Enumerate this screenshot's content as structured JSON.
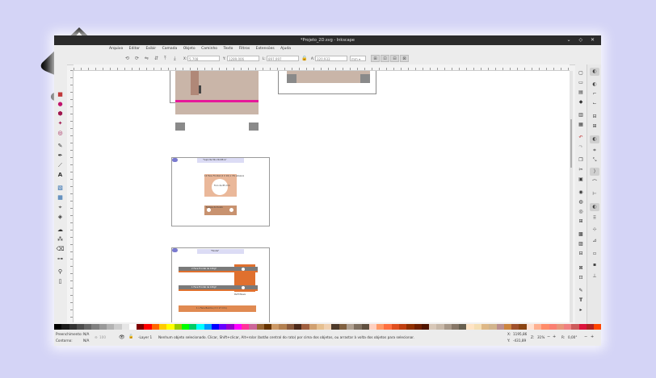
{
  "window": {
    "title": "*Projeto_2D.svg - Inkscape",
    "controls": "⌄ ◇ ✕"
  },
  "menubar": [
    "Arquivo",
    "Editar",
    "Exibir",
    "Camada",
    "Objeto",
    "Caminho",
    "Texto",
    "Filtros",
    "Extensões",
    "Ajuda"
  ],
  "controlbar": {
    "x_label": "X:",
    "x_value": "5,708",
    "y_label": "Y:",
    "y_value": "1289,006",
    "w_label": "L:",
    "w_value": "897,997",
    "h_label": "A:",
    "h_value": "320,933",
    "units": "mm",
    "units_caret": "▾"
  },
  "canvas": {
    "card1_title": "\"Suporte Mini Notifica\"",
    "card1_labels": [
      "12 Face Frontal (2 X 10) x 3% adesiva",
      "Furo de 85 mm",
      "Tampa do fundo"
    ],
    "card2_title": "\"Fenda\"",
    "card2_labels": [
      "2 Face Frontal de 10Kgf",
      "1 Face Frontal de 10Kgf",
      "1 x Face Bainha (2 X 17 mm)",
      "Perfil Nave"
    ]
  },
  "statusbar": {
    "fill_label": "Preenchimento:",
    "fill_value": "N/A",
    "stroke_label": "Contorno:",
    "stroke_value": "N/A",
    "opacity_value": "100",
    "layer": "-Layer 1",
    "message": "Nenhum objeto selecionado. Clicar, Shift+clicar, Alt+rolar (botão central do rato) por cima dos objetos, ou arrastar à volta dos objetos para selecionar.",
    "x_label": "X:",
    "x_value": "1195,86",
    "y_label": "Y:",
    "y_value": "-431,89",
    "zoom_label": "Z:",
    "zoom_value": "31%",
    "rotation_label": "R:",
    "rotation_value": "0,00°"
  },
  "colors": {
    "titlebar": "#2b2b2b",
    "tan": "#c9b5a8",
    "peach": "#eab89a",
    "orange": "#e0702e",
    "magenta": "#e6189a",
    "dark_gray": "#8a8a8a",
    "palette": [
      "#000000",
      "#1a1a1a",
      "#333333",
      "#4d4d4d",
      "#666666",
      "#808080",
      "#999999",
      "#b3b3b3",
      "#cccccc",
      "#e6e6e6",
      "#ffffff",
      "#800000",
      "#ff0000",
      "#ff6600",
      "#ffcc00",
      "#ffff00",
      "#99cc00",
      "#00ff00",
      "#00cc66",
      "#00ffff",
      "#0099ff",
      "#0000ff",
      "#6600ff",
      "#9900cc",
      "#ff00ff",
      "#ff3399",
      "#cc6699",
      "#996633",
      "#663300",
      "#cc9966",
      "#b38050",
      "#8a5a3c",
      "#4d2a1a",
      "#a06040",
      "#d0a070",
      "#e6c090",
      "#f0d0b0",
      "#4d3a2a",
      "#806040",
      "#b0a090",
      "#807060",
      "#605040",
      "#ffd0c0",
      "#ff9966",
      "#ff7040",
      "#e05020",
      "#c04010",
      "#903000",
      "#702000",
      "#501500",
      "#d8c8b8",
      "#c8b8a8",
      "#a89888",
      "#887868",
      "#686050",
      "#ffe4c4",
      "#f5deb3",
      "#deb887",
      "#d2b48c",
      "#bc8f8f",
      "#cd853f",
      "#a0522d",
      "#8b4513",
      "#ffe0d0",
      "#ffb090",
      "#ff8c69",
      "#fa8072",
      "#e9967a",
      "#f08080",
      "#cd5c5c",
      "#dc143c",
      "#b22222",
      "#ff4500"
    ]
  },
  "icons": {
    "toolbox": [
      "selector-icon",
      "node-icon",
      "zoom-icon",
      "rect-icon",
      "box3d-icon",
      "ellipse-icon",
      "star-icon",
      "spiral-icon",
      "pencil-icon",
      "pen-icon",
      "calligraphy-icon",
      "text-icon",
      "gradient-icon",
      "mesh-icon",
      "dropper-icon",
      "bucket-icon",
      "tweak-icon",
      "spray-icon",
      "eraser-icon",
      "connector-icon",
      "measure-icon",
      "zoom-out-icon"
    ],
    "commands": [
      "new-doc-icon",
      "open-icon",
      "save-icon",
      "print-icon",
      "import-icon",
      "export-icon",
      "undo-icon",
      "redo-icon",
      "copy-icon",
      "cut-icon",
      "paste-icon",
      "zoom-drawing-icon",
      "zoom-page-icon",
      "duplicate-icon",
      "clone-icon",
      "group-icon",
      "ungroup-icon",
      "fill-stroke-icon",
      "text-font-icon",
      "layers-icon",
      "xml-editor-icon",
      "align-icon",
      "preferences-icon"
    ],
    "snap": [
      "snap-toggle-icon",
      "snap-bbox-icon",
      "snap-bbox-edge-icon",
      "snap-bbox-corner-icon",
      "snap-nodes-icon",
      "snap-path-icon",
      "snap-intersection-icon",
      "snap-guide-icon",
      "snap-midpoint-icon",
      "snap-center-icon",
      "snap-page-icon",
      "snap-grid-icon"
    ]
  }
}
